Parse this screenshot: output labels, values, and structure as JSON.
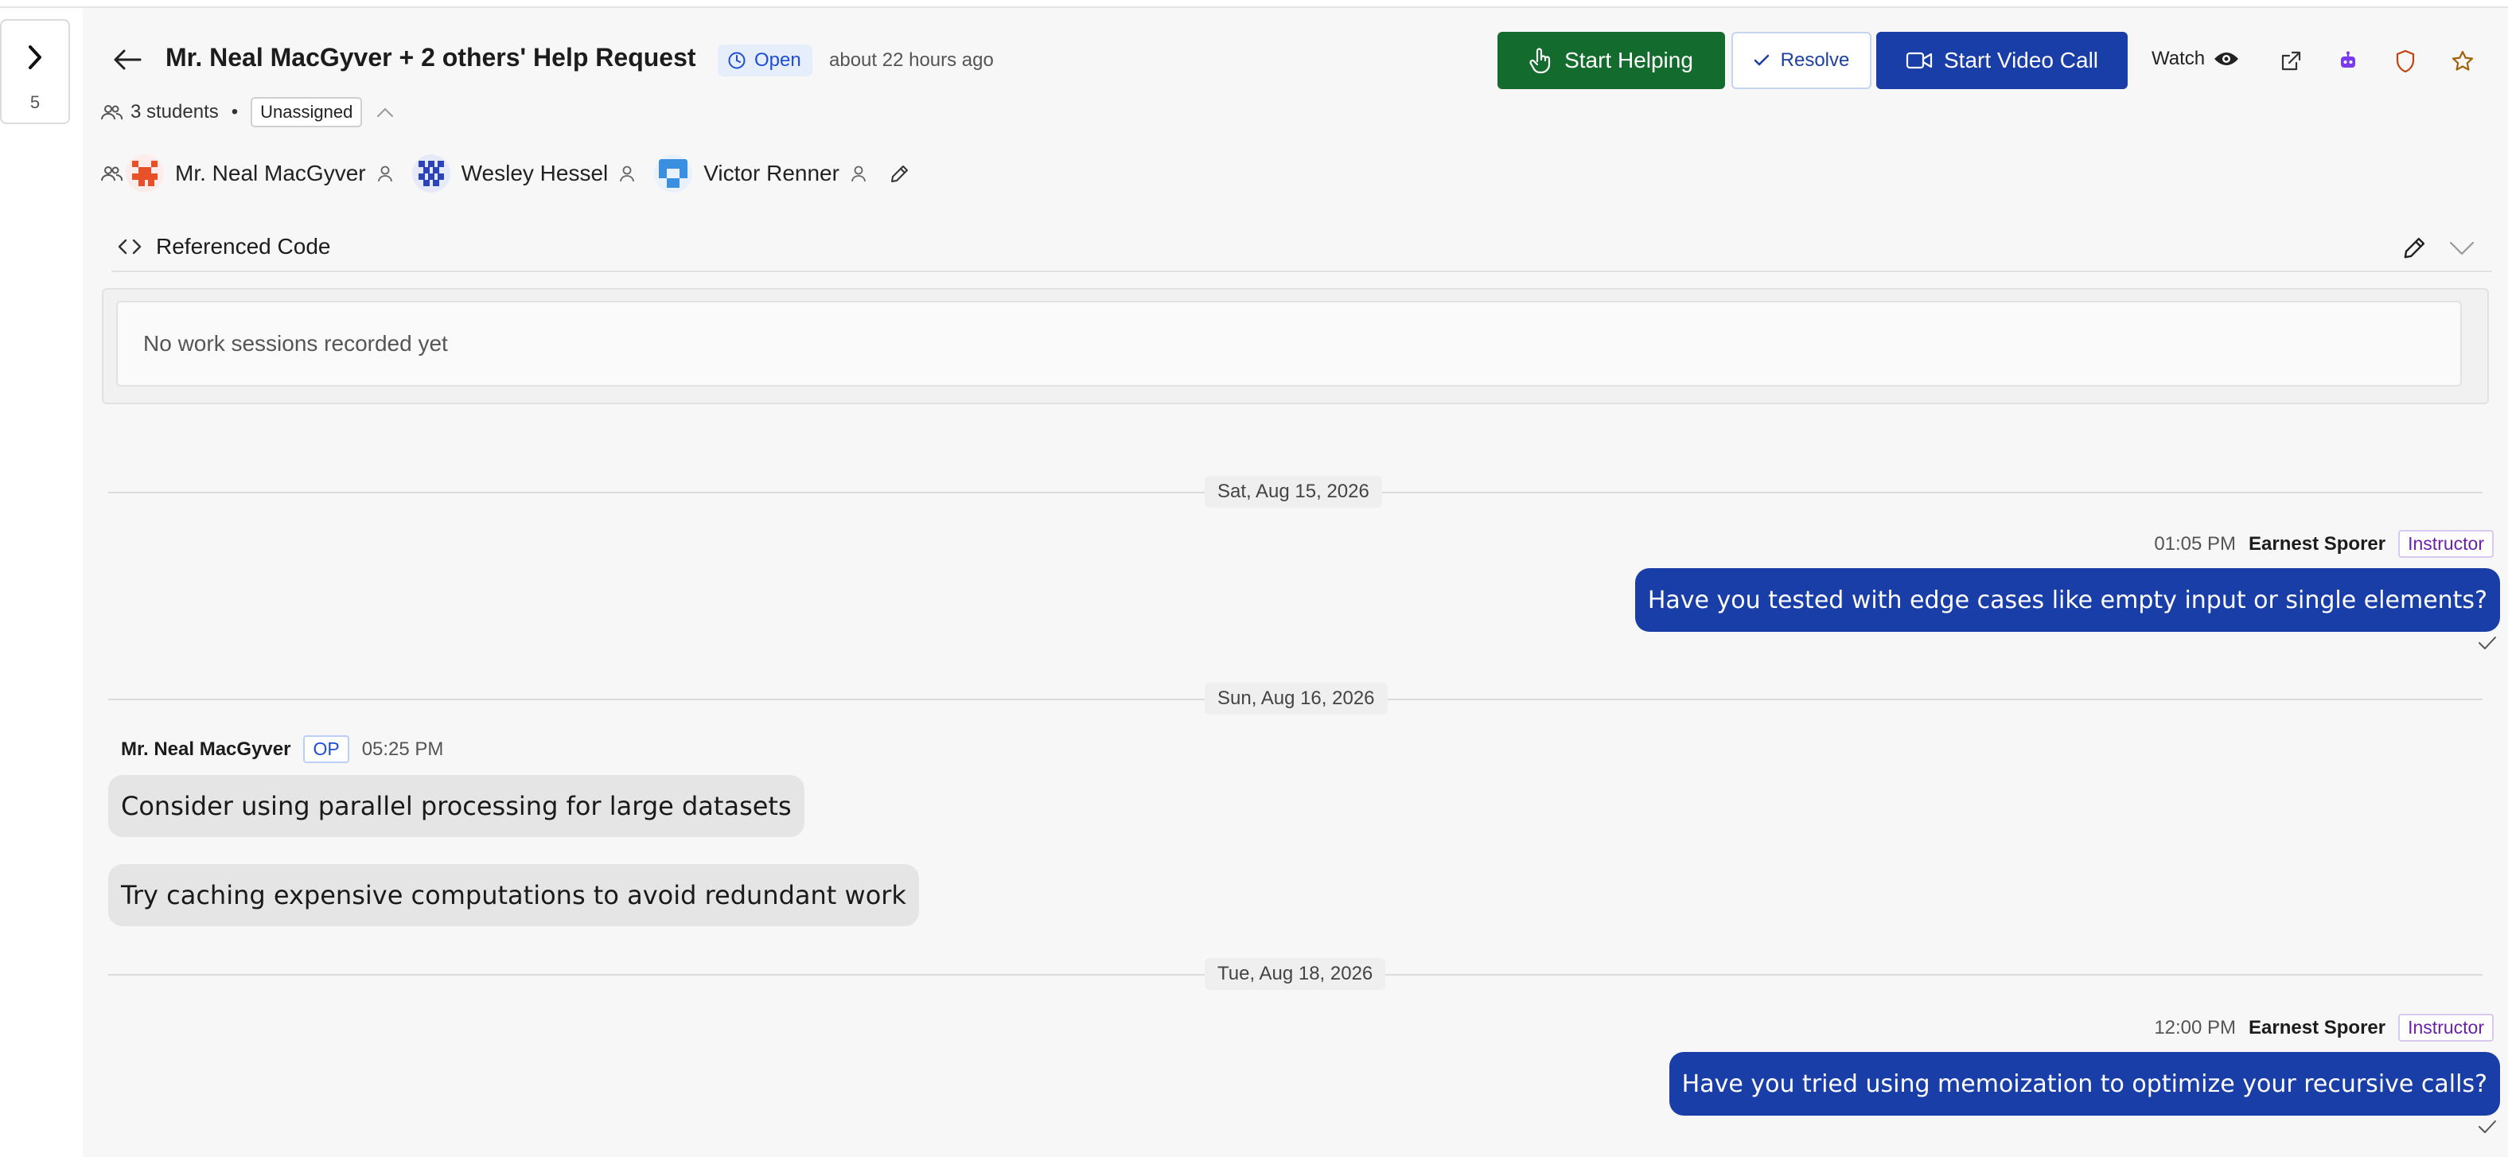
{
  "sidebar": {
    "count": "5",
    "expand_icon": "chevron-right-icon"
  },
  "header": {
    "title": "Mr. Neal MacGyver + 2 others' Help Request",
    "status": "Open",
    "age": "about 22 hours ago",
    "start_helping_label": "Start Helping",
    "resolve_label": "Resolve",
    "video_call_label": "Start Video Call",
    "watch_label": "Watch"
  },
  "students": {
    "count_label": "3 students",
    "separator": "•",
    "assignee": "Unassigned",
    "people": [
      {
        "name": "Mr. Neal MacGyver"
      },
      {
        "name": "Wesley Hessel"
      },
      {
        "name": "Victor Renner"
      }
    ]
  },
  "referenced_code": {
    "label": "Referenced Code",
    "empty_text": "No work sessions recorded yet"
  },
  "chat": {
    "dates": [
      "Sat, Aug 15, 2026",
      "Sun, Aug 16, 2026",
      "Tue, Aug 18, 2026"
    ],
    "messages": [
      {
        "time": "01:05 PM",
        "author": "Earnest Sporer",
        "role": "Instructor",
        "text": "Have you tested with edge cases like empty input or single elements?"
      },
      {
        "time": "05:25 PM",
        "author": "Mr. Neal MacGyver",
        "role": "OP",
        "text": "Consider using parallel processing for large datasets"
      },
      {
        "text": "Try caching expensive computations to avoid redundant work"
      },
      {
        "time": "12:00 PM",
        "author": "Earnest Sporer",
        "role": "Instructor",
        "text": "Have you tried using memoization to optimize your recursive calls?"
      }
    ]
  },
  "colors": {
    "start_helping": "#136c2e",
    "video_call": "#1a3ea8",
    "instructor_bubble": "#1a3ea8",
    "student_bubble": "#e5e5e5",
    "instructor_tag": "#6b21a8",
    "op_tag": "#1d4ed8"
  }
}
